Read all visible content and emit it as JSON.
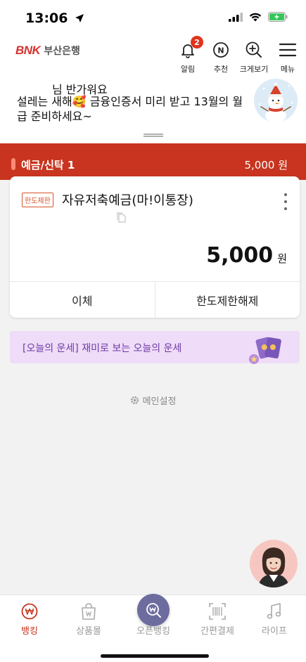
{
  "status": {
    "time": "13:06"
  },
  "header": {
    "logo_mark": "BNK",
    "logo_text": "부산은행",
    "buttons": [
      {
        "label": "알림",
        "icon": "bell-icon",
        "badge": "2"
      },
      {
        "label": "추천",
        "icon": "n-circle-icon",
        "icon_text": "N"
      },
      {
        "label": "크게보기",
        "icon": "zoom-in-icon"
      },
      {
        "label": "메뉴",
        "icon": "hamburger-menu-icon"
      }
    ]
  },
  "greeting": {
    "name_line": "님 반가워요",
    "message": "설레는 새해🥰 금융인증서 미리 받고 13월의 월급 준비하세요~"
  },
  "account_group": {
    "category": "예금/신탁 1",
    "total": "5,000 원"
  },
  "account_card": {
    "limit_badge": "한도제한",
    "name": "자유저축예금(마!이통장)",
    "balance": "5,000",
    "unit": "원",
    "actions": [
      "이체",
      "한도제한해제"
    ]
  },
  "fortune_banner": {
    "text": "[오늘의 운세] 재미로 보는 오늘의 운세"
  },
  "main_setting": {
    "label": "메인설정"
  },
  "tabbar": {
    "tabs": [
      {
        "label": "뱅킹",
        "icon": "won-circle-icon",
        "active": true
      },
      {
        "label": "상품몰",
        "icon": "shopping-bag-icon",
        "active": false
      },
      {
        "label": "오픈뱅킹",
        "icon": "open-banking-icon",
        "active": false
      },
      {
        "label": "간편결제",
        "icon": "barcode-scan-icon",
        "active": false
      },
      {
        "label": "라이프",
        "icon": "music-note-icon",
        "active": false
      }
    ]
  },
  "colors": {
    "brand_red": "#c8341f",
    "fortune_bg": "#eedcf8",
    "fortune_text": "#6f3aa6",
    "open_fab": "#6d6c9e"
  }
}
